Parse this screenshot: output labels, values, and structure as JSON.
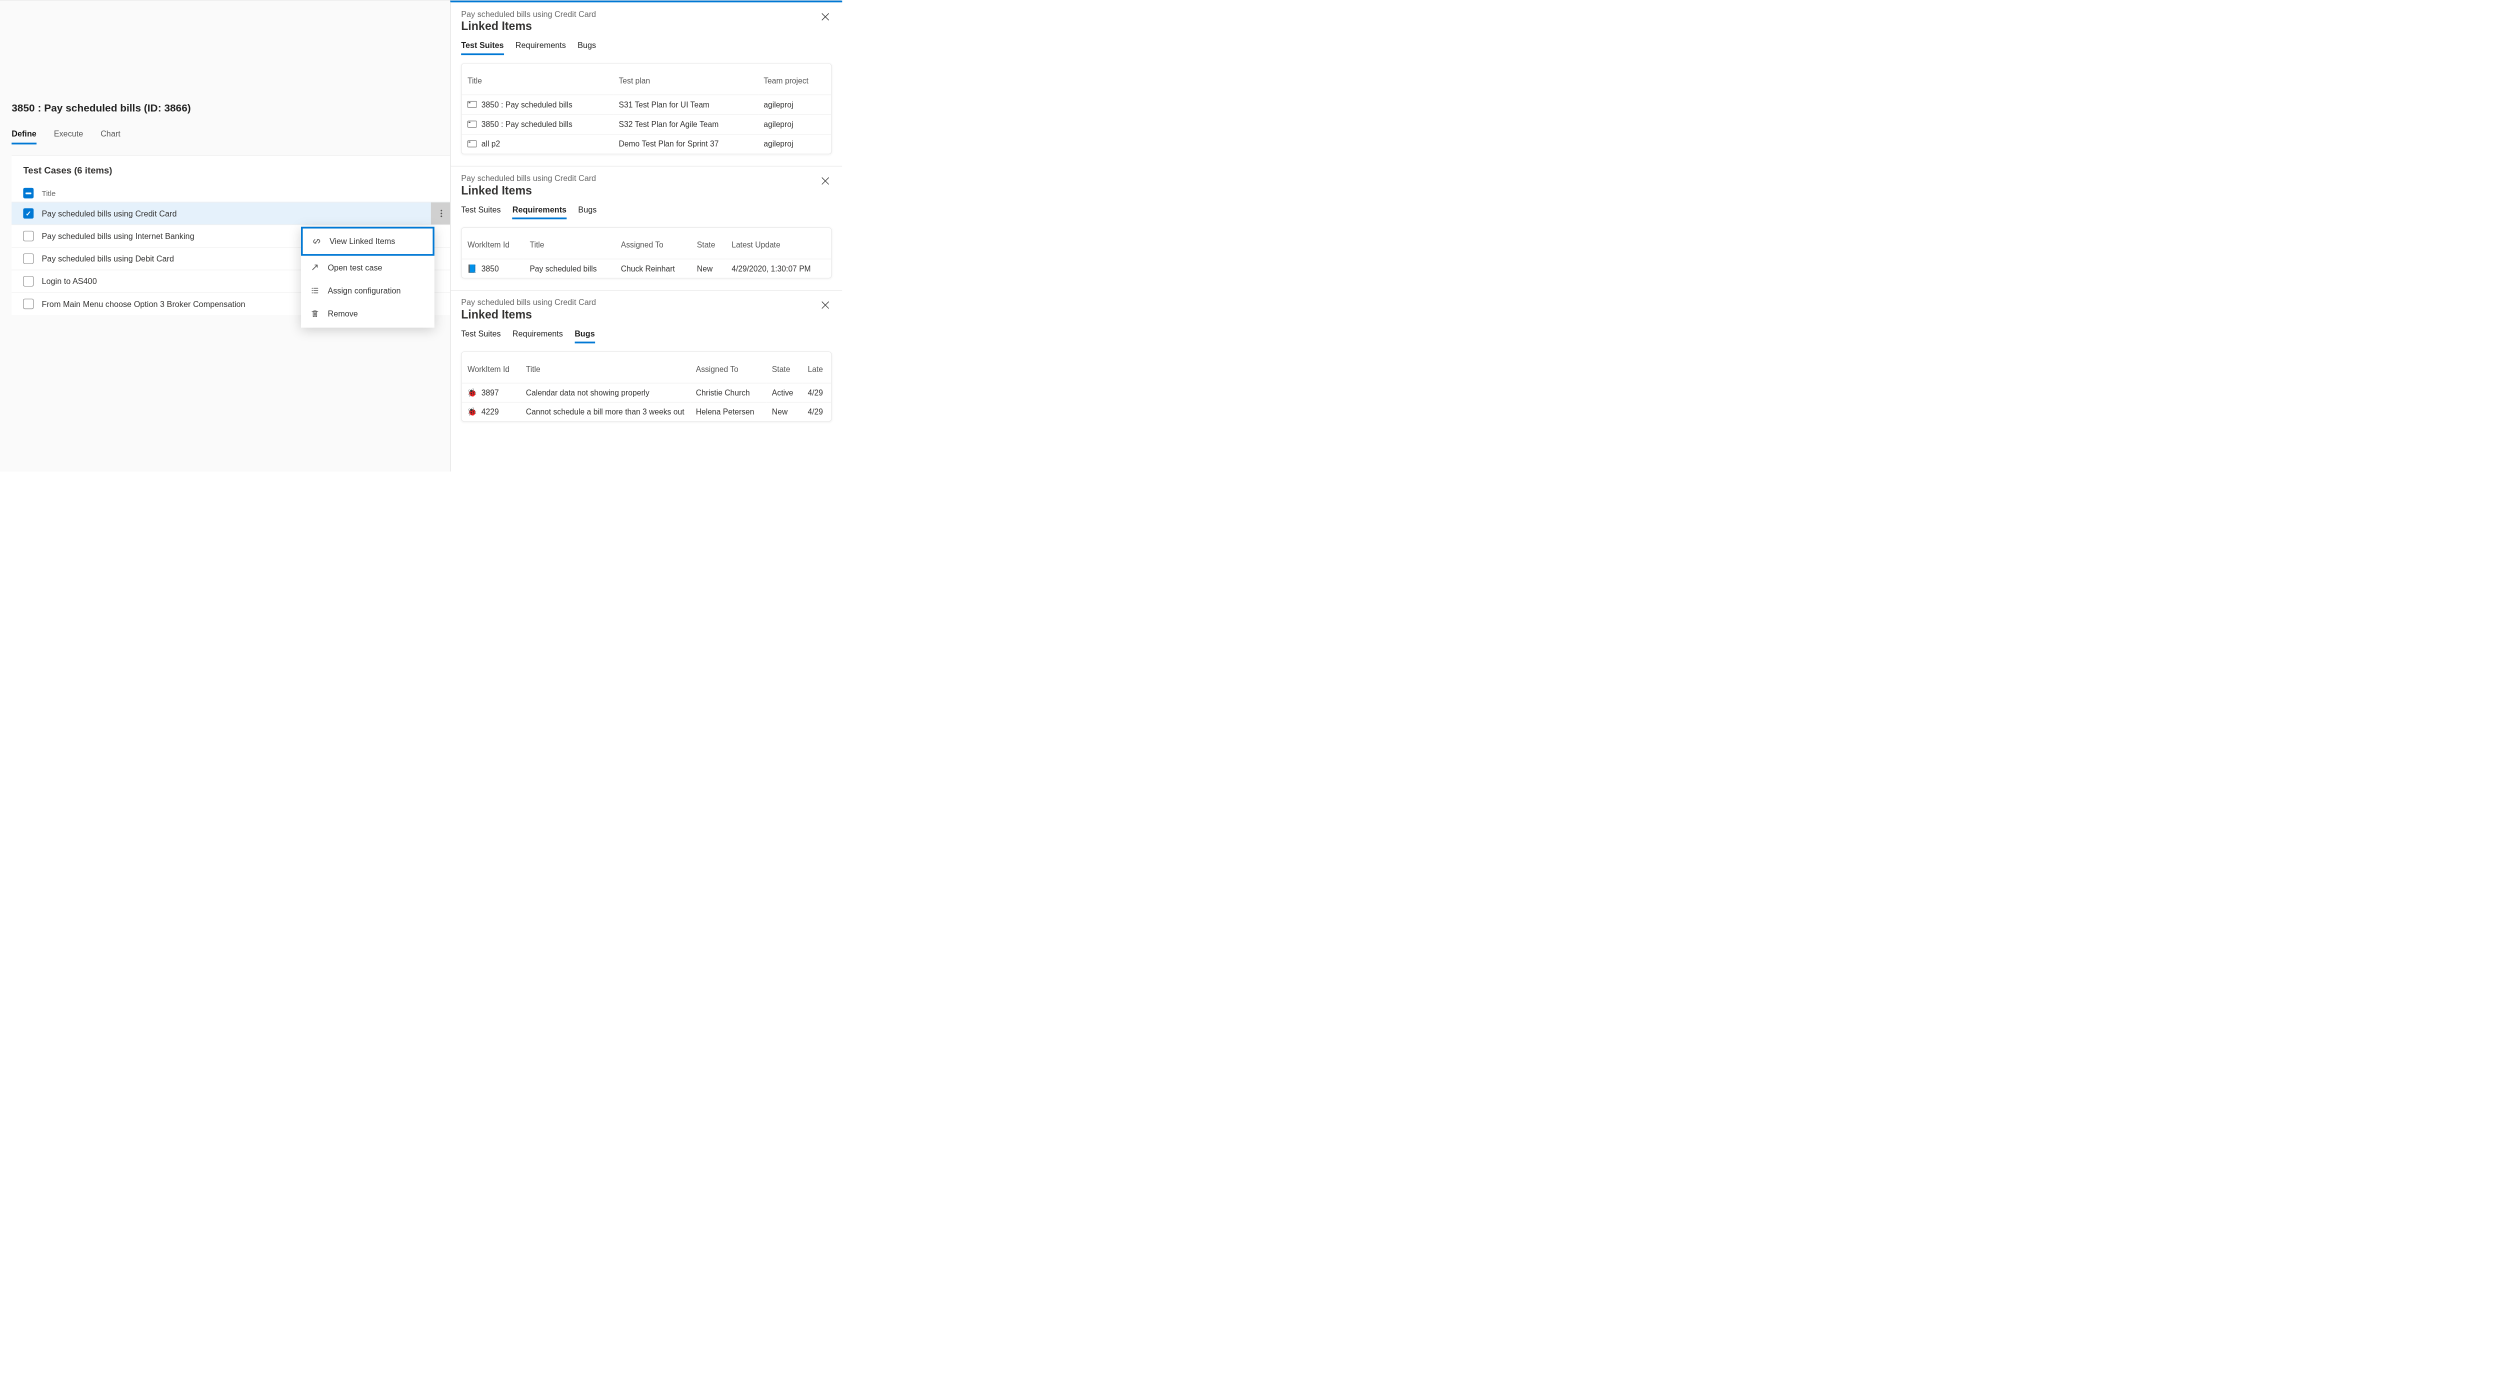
{
  "left": {
    "title": "3850 : Pay scheduled bills (ID: 3866)",
    "tabs": [
      "Define",
      "Execute",
      "Chart"
    ],
    "active_tab": 0,
    "test_cases_heading": "Test Cases (6 items)",
    "title_col": "Title",
    "rows": [
      {
        "title": "Pay scheduled bills using Credit Card",
        "checked": true,
        "selected": true
      },
      {
        "title": "Pay scheduled bills using Internet Banking",
        "checked": false
      },
      {
        "title": "Pay scheduled bills using Debit Card",
        "checked": false
      },
      {
        "title": "Login to AS400",
        "checked": false
      },
      {
        "title": "From Main Menu choose Option 3 Broker Compensation",
        "checked": false
      }
    ],
    "context_menu": {
      "view_linked": "View Linked Items",
      "open": "Open test case",
      "assign": "Assign configuration",
      "remove": "Remove"
    }
  },
  "panels": [
    {
      "breadcrumb": "Pay scheduled bills using Credit Card",
      "title": "Linked Items",
      "tabs": [
        "Test Suites",
        "Requirements",
        "Bugs"
      ],
      "active": 0,
      "columns": [
        "Title",
        "Test plan",
        "Team project"
      ],
      "rows": [
        [
          "3850 : Pay scheduled bills",
          "S31 Test Plan for UI Team",
          "agileproj"
        ],
        [
          "3850 : Pay scheduled bills",
          "S32 Test Plan for Agile Team",
          "agileproj"
        ],
        [
          "all p2",
          "Demo Test Plan for Sprint 37",
          "agileproj"
        ]
      ]
    },
    {
      "breadcrumb": "Pay scheduled bills using Credit Card",
      "title": "Linked Items",
      "tabs": [
        "Test Suites",
        "Requirements",
        "Bugs"
      ],
      "active": 1,
      "columns": [
        "WorkItem Id",
        "Title",
        "Assigned To",
        "State",
        "Latest Update"
      ],
      "rows": [
        [
          "3850",
          "Pay scheduled bills",
          "Chuck Reinhart",
          "New",
          "4/29/2020, 1:30:07 PM"
        ]
      ]
    },
    {
      "breadcrumb": "Pay scheduled bills using Credit Card",
      "title": "Linked Items",
      "tabs": [
        "Test Suites",
        "Requirements",
        "Bugs"
      ],
      "active": 2,
      "columns": [
        "WorkItem Id",
        "Title",
        "Assigned To",
        "State",
        "Late"
      ],
      "rows": [
        [
          "3897",
          "Calendar data not showing properly",
          "Christie Church",
          "Active",
          "4/29"
        ],
        [
          "4229",
          "Cannot schedule a bill more than 3 weeks out",
          "Helena Petersen",
          "New",
          "4/29"
        ]
      ]
    }
  ]
}
